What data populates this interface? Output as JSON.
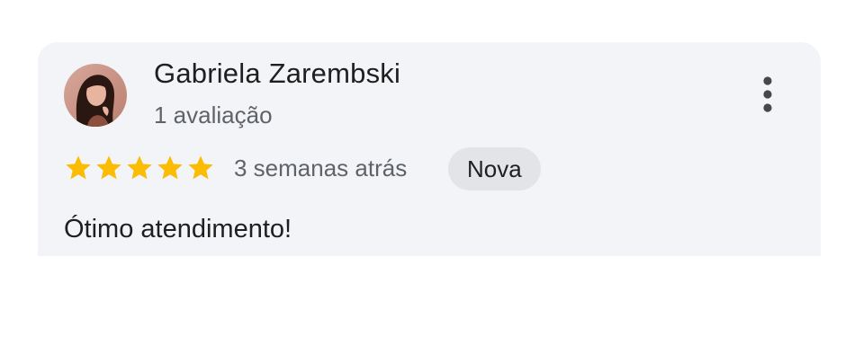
{
  "review": {
    "author_name": "Gabriela Zarembski",
    "review_count": "1 avaliação",
    "rating": 5,
    "rating_max": 5,
    "date": "3 semanas atrás",
    "badge": "Nova",
    "text": "Ótimo atendimento!",
    "avatar_icon": "profile-photo",
    "menu_icon": "more-vert-icon"
  },
  "colors": {
    "card_background": "#f2f4f7",
    "star": "#fbbc04",
    "badge_background": "#e2e4e8",
    "primary_text": "#1f1f1f",
    "secondary_text": "#5f6368"
  }
}
